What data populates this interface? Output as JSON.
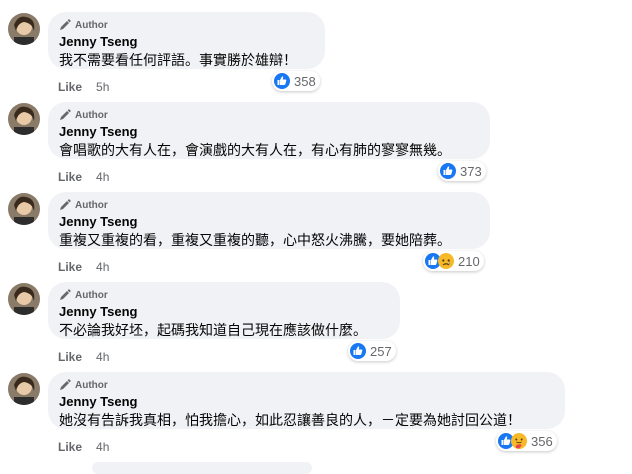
{
  "author_label": "Author",
  "like_label": "Like",
  "comments": [
    {
      "name": "Jenny Tseng",
      "text": "我不需要看任何評語。事實勝於雄辯！",
      "time": "5h",
      "reactions": [
        "like"
      ],
      "count": "358"
    },
    {
      "name": "Jenny Tseng",
      "text": "會唱歌的大有人在，會演戲的大有人在，有心有肺的寥寥無幾。",
      "time": "4h",
      "reactions": [
        "like"
      ],
      "count": "373"
    },
    {
      "name": "Jenny Tseng",
      "text": "重複又重複的看，重複又重複的聽，心中怒火沸騰，要她陪葬。",
      "time": "4h",
      "reactions": [
        "like",
        "sad"
      ],
      "count": "210"
    },
    {
      "name": "Jenny Tseng",
      "text": "不必論我好坯，起碼我知道自己現在應該做什麼。",
      "time": "4h",
      "reactions": [
        "like"
      ],
      "count": "257"
    },
    {
      "name": "Jenny Tseng",
      "text": "她沒有告訴我真相，怕我擔心，如此忍讓善良的人，－定要為她討回公道！",
      "time": "4h",
      "reactions": [
        "like",
        "care"
      ],
      "count": "356"
    }
  ],
  "colors": {
    "like": "#1877f2",
    "bubble": "#f0f2f5",
    "meta": "#65676b"
  }
}
